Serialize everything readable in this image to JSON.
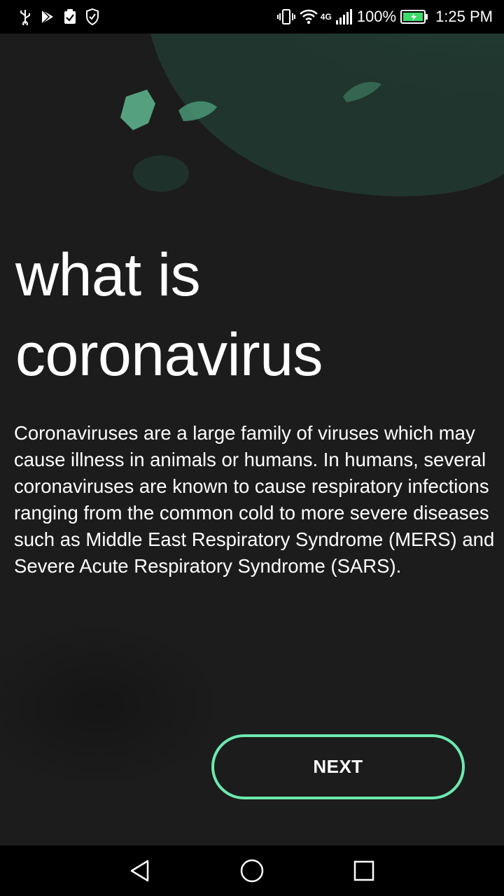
{
  "status_bar": {
    "battery_text": "100%",
    "time": "1:25 PM",
    "network_label": "4G",
    "icons_left": [
      "usb-icon",
      "play-store-icon",
      "clipboard-check-icon",
      "shield-icon"
    ],
    "icons_right": [
      "vibrate-icon",
      "wifi-icon",
      "signal-icon",
      "battery-icon"
    ]
  },
  "content": {
    "title_line1": "what is",
    "title_line2": "coronavirus",
    "description": "Coronaviruses are a large family of viruses which may cause illness in animals or humans. In humans, several coronaviruses are known to cause respiratory infections ranging from the common cold to more severe diseases such as Middle East Respiratory Syndrome (MERS) and Severe Acute Respiratory Syndrome (SARS)."
  },
  "actions": {
    "next_label": "NEXT"
  },
  "nav_bar": {
    "icons": [
      "back-icon",
      "home-icon",
      "recents-icon"
    ]
  },
  "colors": {
    "background": "#1c1c1c",
    "accent": "#6de9b0",
    "text": "#ffffff",
    "bars": "#000000"
  }
}
